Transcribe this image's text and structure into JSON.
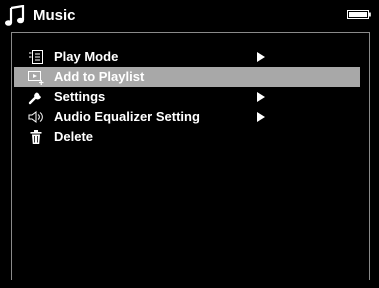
{
  "header": {
    "title": "Music",
    "title_icon": "music-note-icon",
    "status_icon": "battery-icon"
  },
  "menu": {
    "items": [
      {
        "label": "Play Mode",
        "icon": "play-mode-icon",
        "has_submenu": true,
        "selected": false
      },
      {
        "label": "Add to Playlist",
        "icon": "add-to-playlist-icon",
        "has_submenu": false,
        "selected": true
      },
      {
        "label": "Settings",
        "icon": "wrench-icon",
        "has_submenu": true,
        "selected": false
      },
      {
        "label": "Audio Equalizer Setting",
        "icon": "speaker-icon",
        "has_submenu": true,
        "selected": false
      },
      {
        "label": "Delete",
        "icon": "trash-icon",
        "has_submenu": false,
        "selected": false
      }
    ]
  },
  "colors": {
    "background": "#000000",
    "text": "#ffffff",
    "selection": "#a8a8a8",
    "panel_border": "#8a8a8a"
  }
}
